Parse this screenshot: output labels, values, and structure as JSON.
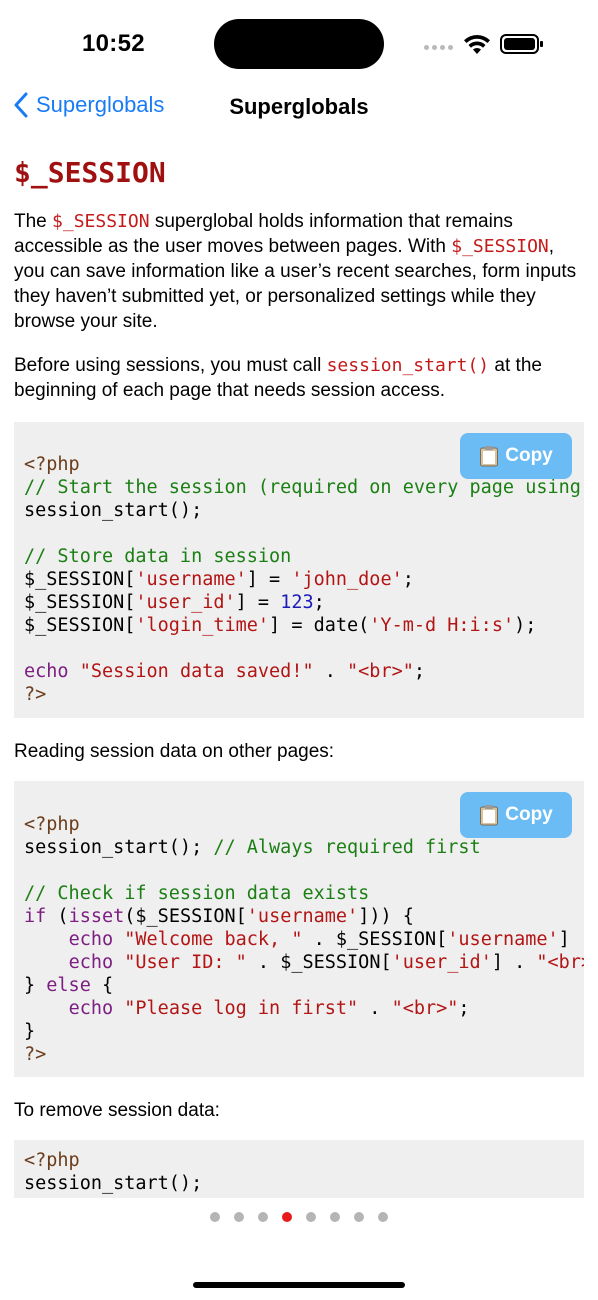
{
  "status": {
    "time": "10:52"
  },
  "nav": {
    "back_label": "Superglobals",
    "title": "Superglobals"
  },
  "page": {
    "heading": "$_SESSION",
    "intro": {
      "p1_a": "The ",
      "p1_code1": "$_SESSION",
      "p1_b": " superglobal holds information that remains accessible as the user moves between pages. With ",
      "p1_code2": "$_SESSION",
      "p1_c": ", you can save information like a user’s recent searches, form inputs they haven’t submitted yet, or personalized settings while they browse your site.",
      "p2_a": "Before using sessions, you must call ",
      "p2_code": "session_start()",
      "p2_b": " at the beginning of each page that needs session access."
    },
    "copy_label": "Copy",
    "reading_label": "Reading session data on other pages:",
    "remove_label": "To remove session data:",
    "code1": [
      "<?php",
      "// Start the session (required on every page using sessions)",
      "session_start();",
      "",
      "// Store data in session",
      "$_SESSION['username'] = 'john_doe';",
      "$_SESSION['user_id'] = 123;",
      "$_SESSION['login_time'] = date('Y-m-d H:i:s');",
      "",
      "echo \"Session data saved!\" . \"<br>\";",
      "?>"
    ],
    "code2": [
      "<?php",
      "session_start(); // Always required first",
      "",
      "// Check if session data exists",
      "if (isset($_SESSION['username'])) {",
      "    echo \"Welcome back, \" . $_SESSION['username'] . \"<br>\";",
      "    echo \"User ID: \" . $_SESSION['user_id'] . \"<br>\";",
      "} else {",
      "    echo \"Please log in first\" . \"<br>\";",
      "}",
      "?>"
    ],
    "code3": [
      "<?php",
      "session_start();"
    ]
  },
  "pager": {
    "count": 8,
    "active_index": 3
  },
  "colors": {
    "accent": "#1a7cf5",
    "heading": "#a01010",
    "copy_button": "#6bbcf5",
    "active_dot": "#e81b1b"
  }
}
